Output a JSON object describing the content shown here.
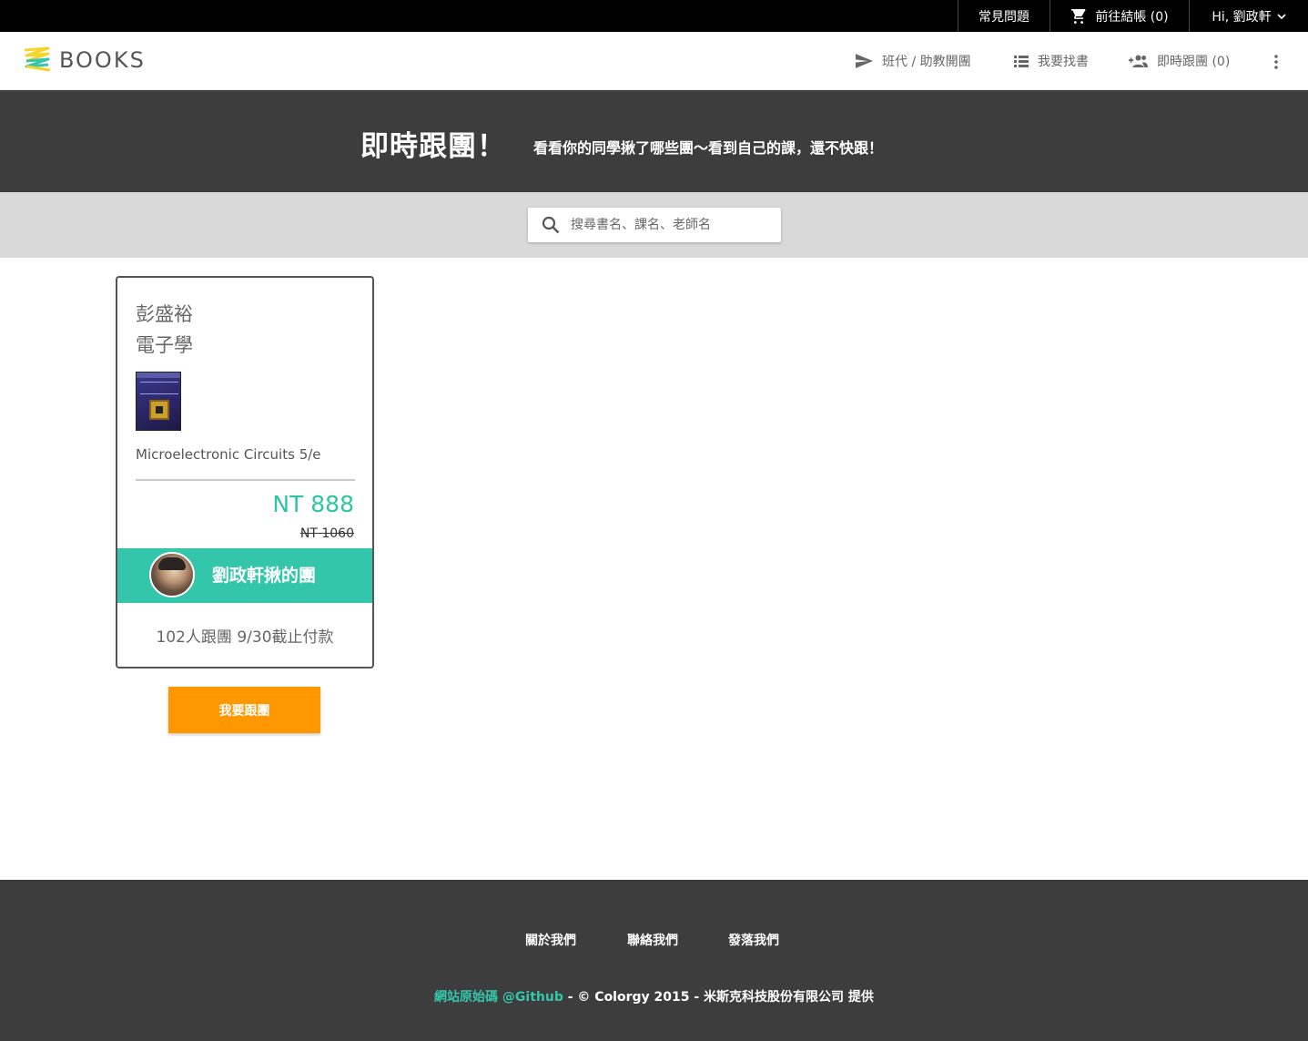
{
  "topbar": {
    "faq": "常見問題",
    "cart": "前往結帳 (0)",
    "user": "Hi, 劉政軒"
  },
  "header": {
    "logo": "BOOKS",
    "nav": {
      "open_group": "班代 / 助教開團",
      "find_book": "我要找書",
      "follow": "即時跟團 (0)"
    }
  },
  "banner": {
    "title": "即時跟團！",
    "subtitle": "看看你的同學揪了哪些團～看到自己的課，還不快跟！"
  },
  "search": {
    "placeholder": "搜尋書名、課名、老師名"
  },
  "card": {
    "teacher": "彭盛裕",
    "course": "電子學",
    "book_title": "Microelectronic Circuits 5/e",
    "price": "NT 888",
    "original_price": "NT 1060",
    "leader_label": "劉政軒揪的團",
    "followers_info": "102人跟團 9/30截止付款"
  },
  "follow_button": "我要跟團",
  "footer": {
    "about": "關於我們",
    "contact": "聯絡我們",
    "blog": "發落我們",
    "github": "網站原始碼 @Github",
    "copyright": " - © Colorgy 2015 - 米斯克科技股份有限公司 提供"
  },
  "colors": {
    "accent": "#33c6aa",
    "button": "#ff9800",
    "banner_bg": "#3d3d3d"
  }
}
